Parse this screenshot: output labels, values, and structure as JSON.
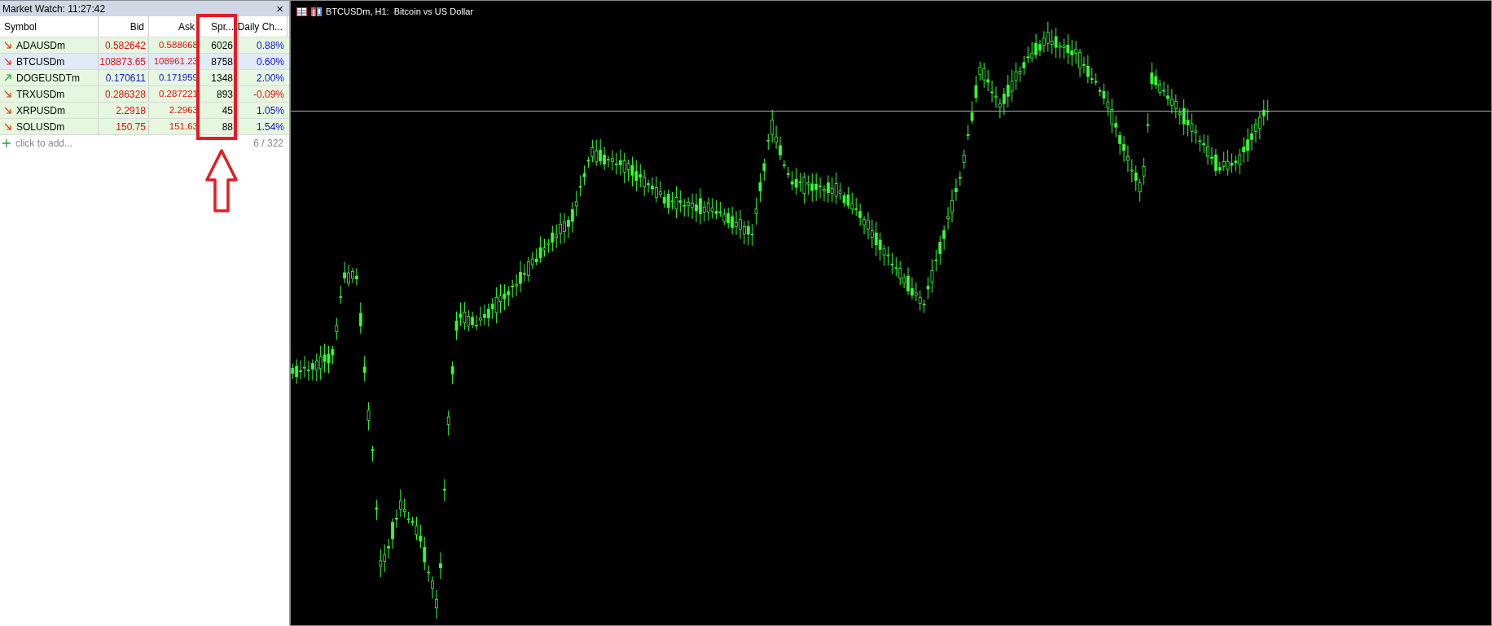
{
  "market_watch": {
    "title": "Market Watch: 11:27:42",
    "close": "×",
    "columns": [
      "Symbol",
      "Bid",
      "Ask",
      "Spr...",
      "Daily Ch..."
    ],
    "rows": [
      {
        "symbol": "ADAUSDm",
        "falling": true,
        "bid": "0.582642",
        "ask": "0.588668",
        "spread": "6026",
        "change": "0.88%",
        "change_negative": false,
        "selected": false
      },
      {
        "symbol": "BTCUSDm",
        "falling": true,
        "bid": "108873.65",
        "ask": "108961.23",
        "spread": "8758",
        "change": "0.60%",
        "change_negative": false,
        "selected": true
      },
      {
        "symbol": "DOGEUSDTm",
        "falling": false,
        "bid": "0.170611",
        "ask": "0.171959",
        "spread": "1348",
        "change": "2.00%",
        "change_negative": false,
        "selected": false
      },
      {
        "symbol": "TRXUSDm",
        "falling": true,
        "bid": "0.286328",
        "ask": "0.287221",
        "spread": "893",
        "change": "-0.09%",
        "change_negative": true,
        "selected": false
      },
      {
        "symbol": "XRPUSDm",
        "falling": true,
        "bid": "2.2918",
        "ask": "2.2963",
        "spread": "45",
        "change": "1.05%",
        "change_negative": false,
        "selected": false
      },
      {
        "symbol": "SOLUSDm",
        "falling": true,
        "bid": "150.75",
        "ask": "151.63",
        "spread": "88",
        "change": "1.54%",
        "change_negative": false,
        "selected": false
      }
    ],
    "add_label": "click to add...",
    "count": "6 / 322"
  },
  "chart": {
    "title": "BTCUSDm, H1:  Bitcoin vs US Dollar"
  }
}
